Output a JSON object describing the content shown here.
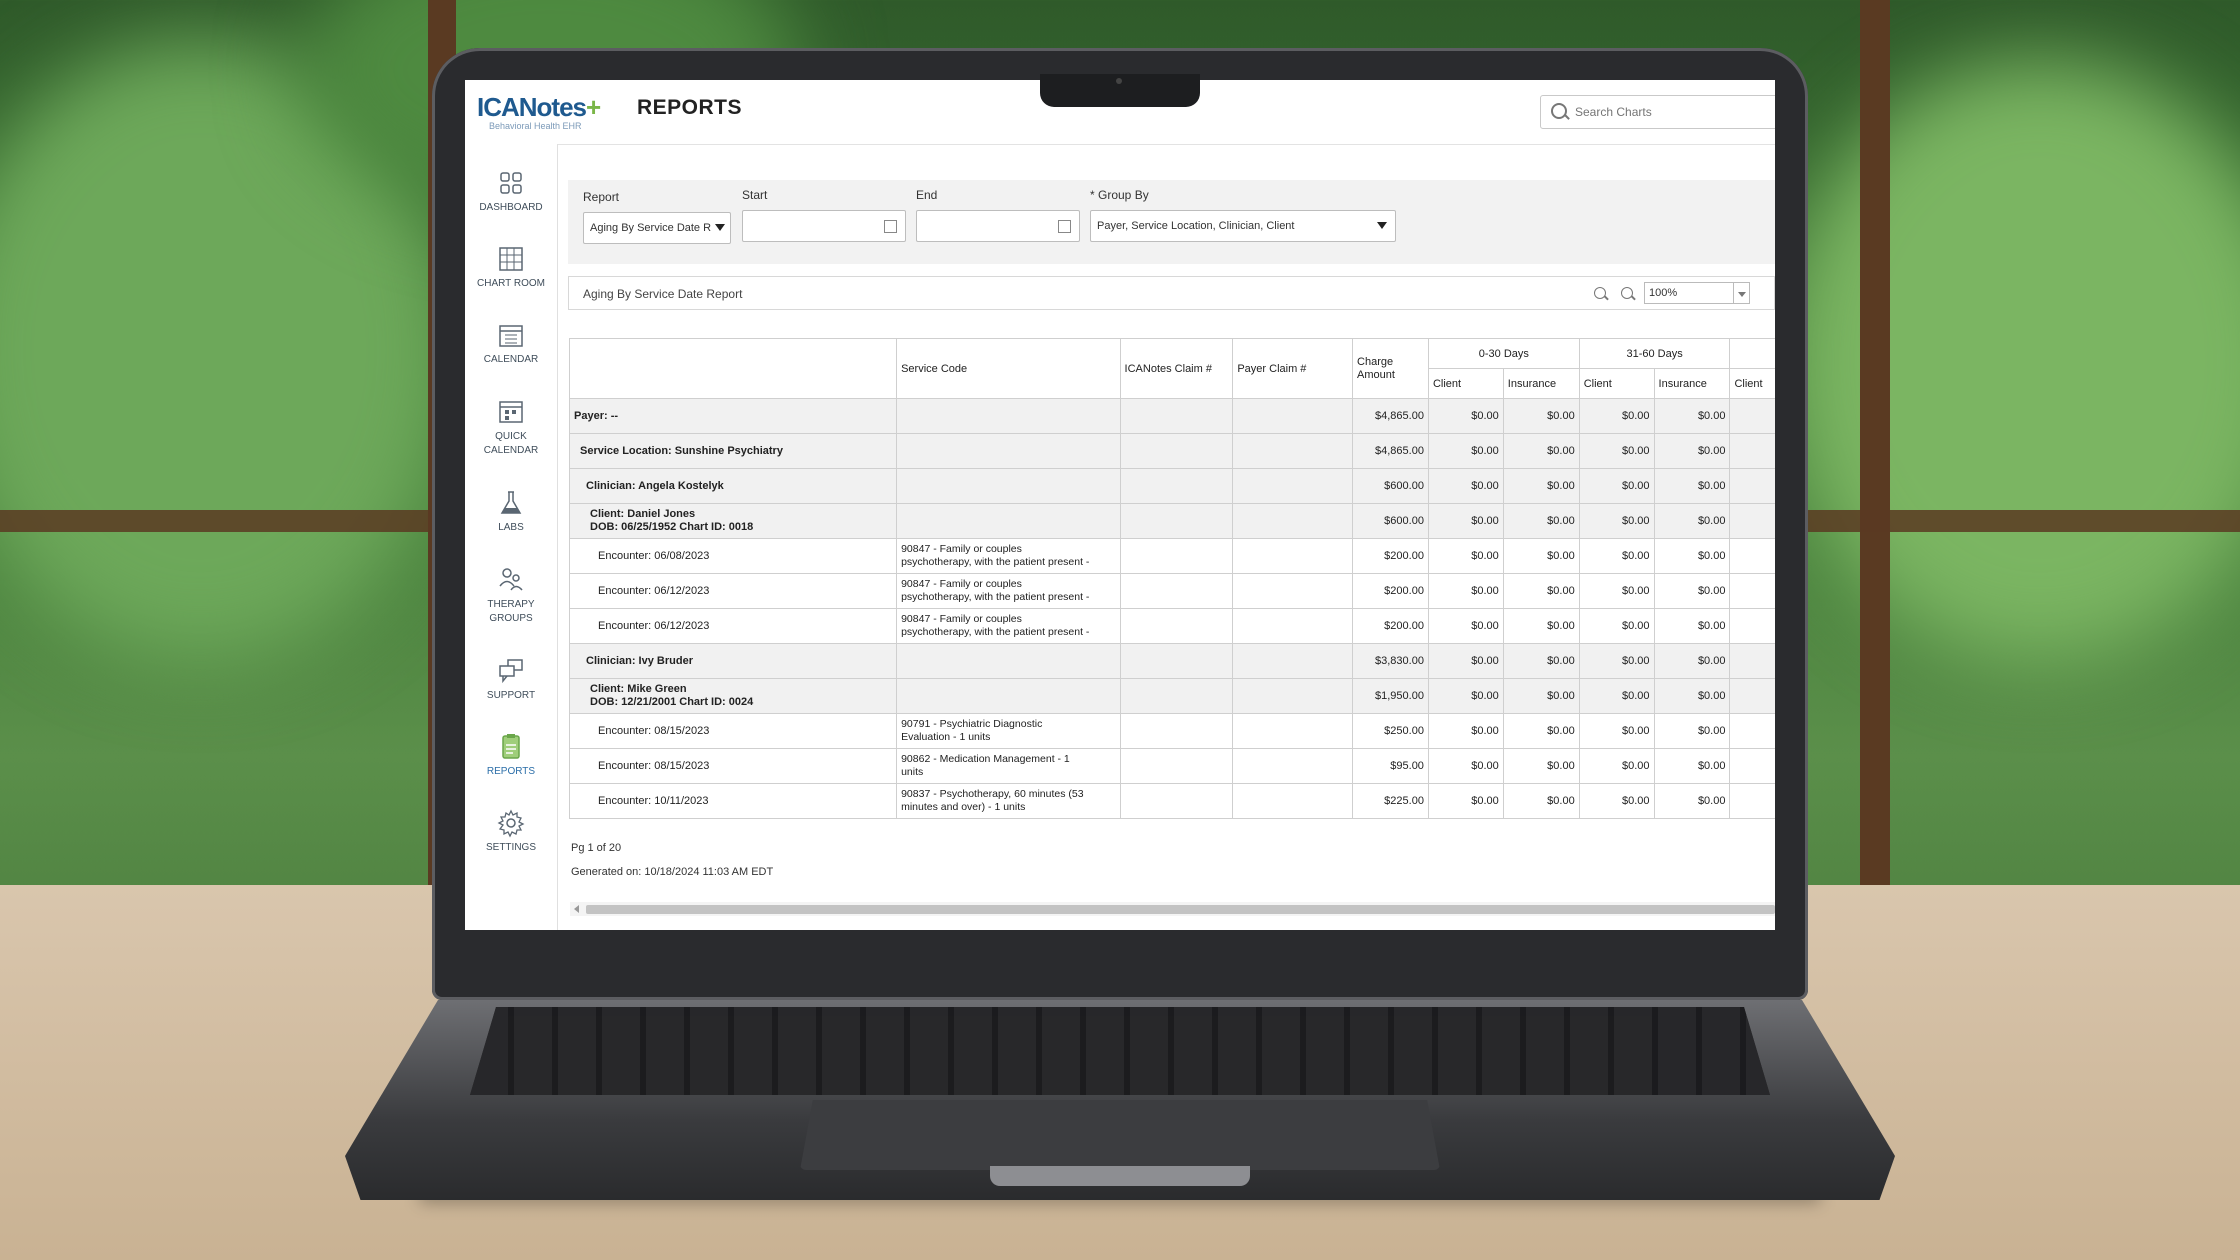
{
  "app": {
    "logo_main": "ICANotes",
    "logo_sub": "Behavioral Health EHR",
    "page_title": "REPORTS",
    "search_placeholder": "Search Charts"
  },
  "sidebar": {
    "items": [
      {
        "label": "DASHBOARD"
      },
      {
        "label": "CHART ROOM"
      },
      {
        "label": "CALENDAR"
      },
      {
        "label": "QUICK CALENDAR"
      },
      {
        "label": "LABS"
      },
      {
        "label": "THERAPY GROUPS"
      },
      {
        "label": "SUPPORT"
      },
      {
        "label": "REPORTS"
      },
      {
        "label": "SETTINGS"
      }
    ]
  },
  "filters": {
    "report_label": "Report",
    "report_value": "Aging By Service Date R",
    "start_label": "Start",
    "start_value": "",
    "end_label": "End",
    "end_value": "",
    "groupby_label": "* Group By",
    "groupby_value": "Payer, Service Location, Clinician, Client"
  },
  "report_bar": {
    "title": "Aging By Service Date Report",
    "zoom": "100%"
  },
  "table": {
    "headers": {
      "service_code": "Service Code",
      "icanotes_claim": "ICANotes Claim #",
      "payer_claim": "Payer Claim #",
      "charge_amount": "Charge Amount",
      "bucket1": "0-30 Days",
      "bucket2": "31-60 Days",
      "client": "Client",
      "insurance": "Insurance"
    },
    "rows": [
      {
        "label": "Payer: --",
        "code": "",
        "charge": "$4,865.00",
        "c1": "$0.00",
        "i1": "$0.00",
        "c2": "$0.00",
        "i2": "$0.00",
        "grp": true
      },
      {
        "label": "Service Location: Sunshine Psychiatry",
        "code": "",
        "charge": "$4,865.00",
        "c1": "$0.00",
        "i1": "$0.00",
        "c2": "$0.00",
        "i2": "$0.00",
        "grp": true
      },
      {
        "label": "Clinician: Angela Kostelyk",
        "code": "",
        "charge": "$600.00",
        "c1": "$0.00",
        "i1": "$0.00",
        "c2": "$0.00",
        "i2": "$0.00",
        "grp": true
      },
      {
        "label": "Client: Daniel Jones",
        "label2": "DOB: 06/25/1952 Chart ID: 0018",
        "code": "",
        "charge": "$600.00",
        "c1": "$0.00",
        "i1": "$0.00",
        "c2": "$0.00",
        "i2": "$0.00",
        "grp": true
      },
      {
        "label": "Encounter: 06/08/2023",
        "code": "90847 - Family or couples",
        "code2": "psychotherapy, with the patient present -",
        "charge": "$200.00",
        "c1": "$0.00",
        "i1": "$0.00",
        "c2": "$0.00",
        "i2": "$0.00",
        "grp": false
      },
      {
        "label": "Encounter: 06/12/2023",
        "code": "90847 - Family or couples",
        "code2": "psychotherapy, with the patient present -",
        "charge": "$200.00",
        "c1": "$0.00",
        "i1": "$0.00",
        "c2": "$0.00",
        "i2": "$0.00",
        "grp": false
      },
      {
        "label": "Encounter: 06/12/2023",
        "code": "90847 - Family or couples",
        "code2": "psychotherapy, with the patient present -",
        "charge": "$200.00",
        "c1": "$0.00",
        "i1": "$0.00",
        "c2": "$0.00",
        "i2": "$0.00",
        "grp": false
      },
      {
        "label": "Clinician: Ivy Bruder",
        "code": "",
        "charge": "$3,830.00",
        "c1": "$0.00",
        "i1": "$0.00",
        "c2": "$0.00",
        "i2": "$0.00",
        "grp": true
      },
      {
        "label": "Client: Mike Green",
        "label2": "DOB: 12/21/2001 Chart ID: 0024",
        "code": "",
        "charge": "$1,950.00",
        "c1": "$0.00",
        "i1": "$0.00",
        "c2": "$0.00",
        "i2": "$0.00",
        "grp": true
      },
      {
        "label": "Encounter: 08/15/2023",
        "code": "90791 - Psychiatric Diagnostic",
        "code2": "Evaluation - 1 units",
        "charge": "$250.00",
        "c1": "$0.00",
        "i1": "$0.00",
        "c2": "$0.00",
        "i2": "$0.00",
        "grp": false
      },
      {
        "label": "Encounter: 08/15/2023",
        "code": "90862 - Medication Management - 1",
        "code2": "units",
        "charge": "$95.00",
        "c1": "$0.00",
        "i1": "$0.00",
        "c2": "$0.00",
        "i2": "$0.00",
        "grp": false
      },
      {
        "label": "Encounter: 10/11/2023",
        "code": "90837 - Psychotherapy, 60 minutes (53",
        "code2": "minutes and over) - 1 units",
        "charge": "$225.00",
        "c1": "$0.00",
        "i1": "$0.00",
        "c2": "$0.00",
        "i2": "$0.00",
        "grp": false
      }
    ]
  },
  "footer": {
    "pager": "Pg 1 of 20",
    "generated": "Generated on: 10/18/2024 11:03 AM EDT"
  },
  "colors": {
    "brand_blue": "#1f5a8f",
    "brand_green": "#7ab648"
  }
}
